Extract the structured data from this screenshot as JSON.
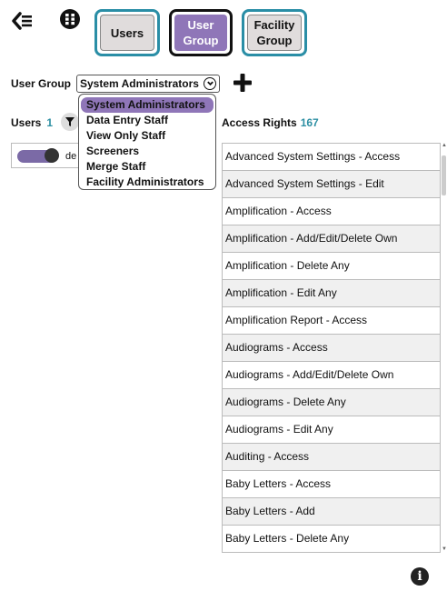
{
  "toolbar": {
    "back_icon": "collapse-menu-icon",
    "grid_icon": "grid-menu-icon",
    "tabs": [
      {
        "label_line1": "Users",
        "label_line2": "",
        "active": false
      },
      {
        "label_line1": "User",
        "label_line2": "Group",
        "active": true
      },
      {
        "label_line1": "Facility",
        "label_line2": "Group",
        "active": false
      }
    ]
  },
  "user_group": {
    "label": "User Group",
    "selected": "System Administrators",
    "options": [
      "System Administrators",
      "Data Entry Staff",
      "View Only Staff",
      "Screeners",
      "Merge Staff",
      "Facility Administrators"
    ]
  },
  "users": {
    "label": "Users",
    "count": "1",
    "items": [
      {
        "name": "de",
        "enabled": true
      }
    ]
  },
  "access_rights": {
    "label": "Access Rights",
    "count": "167",
    "rows": [
      "Advanced System Settings - Access",
      "Advanced System Settings - Edit",
      "Amplification - Access",
      "Amplification - Add/Edit/Delete Own",
      "Amplification - Delete Any",
      "Amplification - Edit Any",
      "Amplification Report - Access",
      "Audiograms - Access",
      "Audiograms - Add/Edit/Delete Own",
      "Audiograms - Delete Any",
      "Audiograms - Edit Any",
      "Auditing - Access",
      "Baby Letters - Access",
      "Baby Letters - Add",
      "Baby Letters - Delete Any"
    ]
  },
  "colors": {
    "accent_teal": "#2d8fa3",
    "tab_inactive_bg": "#e0dcdc",
    "tab_active_bg": "#8f76b8",
    "toggle": "#7b6aa6"
  }
}
